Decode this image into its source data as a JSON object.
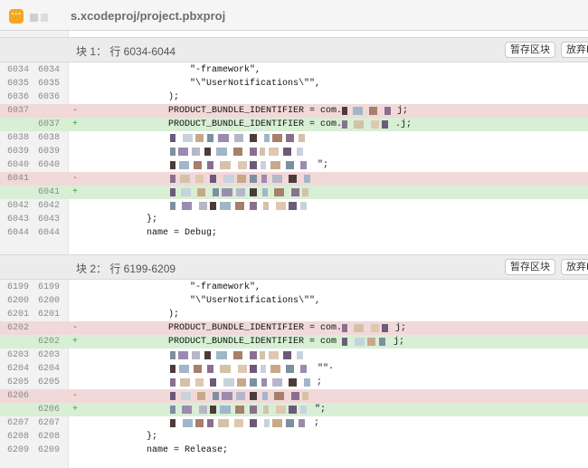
{
  "header": {
    "badge": "···",
    "file_name": "s.xcodeproj/project.pbxproj"
  },
  "hunks": [
    {
      "title": "块 1： 行 6034-6044",
      "stage_label": "暂存区块",
      "discard_label": "放弃I",
      "lines": [
        {
          "old": "6034",
          "new": "6034",
          "type": "ctx",
          "sign": "",
          "text": "\"-framework\",",
          "indent": 4
        },
        {
          "old": "6035",
          "new": "6035",
          "type": "ctx",
          "sign": "",
          "text": "\"\\\"UserNotifications\\\"\",",
          "indent": 4
        },
        {
          "old": "6036",
          "new": "6036",
          "type": "ctx",
          "sign": "",
          "text": ");",
          "indent": 3
        },
        {
          "old": "6037",
          "new": "",
          "type": "del",
          "sign": "-",
          "text": "PRODUCT_BUNDLE_IDENTIFIER = com.",
          "tail": "j;",
          "indent": 3
        },
        {
          "old": "",
          "new": "6037",
          "type": "add",
          "sign": "+",
          "text": "PRODUCT_BUNDLE_IDENTIFIER = com.",
          "tail": ".j;",
          "indent": 3
        },
        {
          "old": "6038",
          "new": "6038",
          "type": "ctx",
          "sign": "",
          "text": "",
          "indent": 3
        },
        {
          "old": "6039",
          "new": "6039",
          "type": "ctx",
          "sign": "",
          "text": "",
          "indent": 3
        },
        {
          "old": "6040",
          "new": "6040",
          "type": "ctx",
          "sign": "",
          "text": "",
          "tail": "\";",
          "indent": 3
        },
        {
          "old": "6041",
          "new": "",
          "type": "del",
          "sign": "-",
          "text": "",
          "indent": 3
        },
        {
          "old": "",
          "new": "6041",
          "type": "add",
          "sign": "+",
          "text": "",
          "indent": 3
        },
        {
          "old": "6042",
          "new": "6042",
          "type": "ctx",
          "sign": "",
          "text": "",
          "indent": 3
        },
        {
          "old": "6043",
          "new": "6043",
          "type": "ctx",
          "sign": "",
          "text": "};",
          "indent": 2
        },
        {
          "old": "6044",
          "new": "6044",
          "type": "ctx",
          "sign": "",
          "text": "name = Debug;",
          "indent": 2
        }
      ]
    },
    {
      "title": "块 2： 行 6199-6209",
      "stage_label": "暂存区块",
      "discard_label": "放弃I",
      "lines": [
        {
          "old": "6199",
          "new": "6199",
          "type": "ctx",
          "sign": "",
          "text": "\"-framework\",",
          "indent": 4
        },
        {
          "old": "6200",
          "new": "6200",
          "type": "ctx",
          "sign": "",
          "text": "\"\\\"UserNotifications\\\"\",",
          "indent": 4
        },
        {
          "old": "6201",
          "new": "6201",
          "type": "ctx",
          "sign": "",
          "text": ");",
          "indent": 3
        },
        {
          "old": "6202",
          "new": "",
          "type": "del",
          "sign": "-",
          "text": "PRODUCT_BUNDLE_IDENTIFIER = com.",
          "tail": "j;",
          "indent": 3
        },
        {
          "old": "",
          "new": "6202",
          "type": "add",
          "sign": "+",
          "text": "PRODUCT_BUNDLE_IDENTIFIER = com",
          "tail": "j;",
          "indent": 3
        },
        {
          "old": "6203",
          "new": "6203",
          "type": "ctx",
          "sign": "",
          "text": "",
          "indent": 3
        },
        {
          "old": "6204",
          "new": "6204",
          "type": "ctx",
          "sign": "",
          "text": "",
          "tail": "\"\"·",
          "indent": 3
        },
        {
          "old": "6205",
          "new": "6205",
          "type": "ctx",
          "sign": "",
          "text": "",
          "tail": ";",
          "indent": 3
        },
        {
          "old": "6206",
          "new": "",
          "type": "del",
          "sign": "-",
          "text": "",
          "indent": 3
        },
        {
          "old": "",
          "new": "6206",
          "type": "add",
          "sign": "+",
          "text": "",
          "tail": "\";",
          "indent": 3
        },
        {
          "old": "6207",
          "new": "6207",
          "type": "ctx",
          "sign": "",
          "text": "",
          "tail": ";",
          "indent": 3
        },
        {
          "old": "6208",
          "new": "6208",
          "type": "ctx",
          "sign": "",
          "text": "};",
          "indent": 2
        },
        {
          "old": "6209",
          "new": "6209",
          "type": "ctx",
          "sign": "",
          "text": "name = Release;",
          "indent": 2
        }
      ]
    }
  ]
}
